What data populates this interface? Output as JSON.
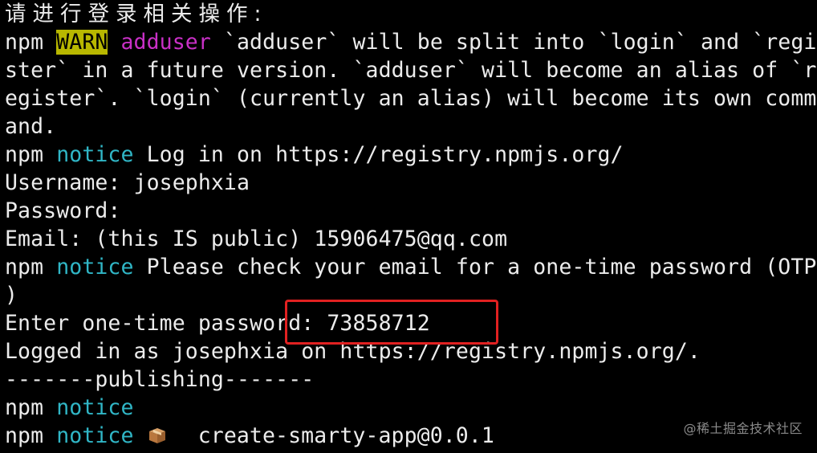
{
  "terminal": {
    "lines": [
      {
        "text": "请进行登录相关操作:"
      },
      {
        "prefix": "npm ",
        "warn": "WARN",
        "sep": " ",
        "cmd": "adduser",
        "rest": " `adduser` will be split into `login` and `regi"
      },
      {
        "text": "ster` in a future version. `adduser` will become an alias of `r"
      },
      {
        "text": "egister`. `login` (currently an alias) will become its own comm"
      },
      {
        "text": "and."
      },
      {
        "prefix": "npm ",
        "notice": "notice",
        "rest": " Log in on https://registry.npmjs.org/"
      },
      {
        "text": "Username: josephxia"
      },
      {
        "text": "Password:"
      },
      {
        "text": "Email: (this IS public) 15906475@qq.com"
      },
      {
        "prefix": "npm ",
        "notice": "notice",
        "rest": " Please check your email for a one-time password (OTP"
      },
      {
        "text": ")"
      },
      {
        "text": "Enter one-time password: 73858712"
      },
      {
        "text": "Logged in as josephxia on https://registry.npmjs.org/."
      },
      {
        "text": "-------publishing-------"
      },
      {
        "prefix": "npm ",
        "notice": "notice",
        "rest": ""
      },
      {
        "prefix": "npm ",
        "notice": "notice",
        "icon": "package-icon",
        "rest": "  create-smarty-app@0.0.1"
      }
    ],
    "colors": {
      "background": "#000000",
      "foreground": "#ececec",
      "warn_bg": "#b8b700",
      "magenta": "#c930c7",
      "cyan": "#30b6c6",
      "highlight": "#e12121"
    }
  },
  "watermark": "@稀土掘金技术社区"
}
